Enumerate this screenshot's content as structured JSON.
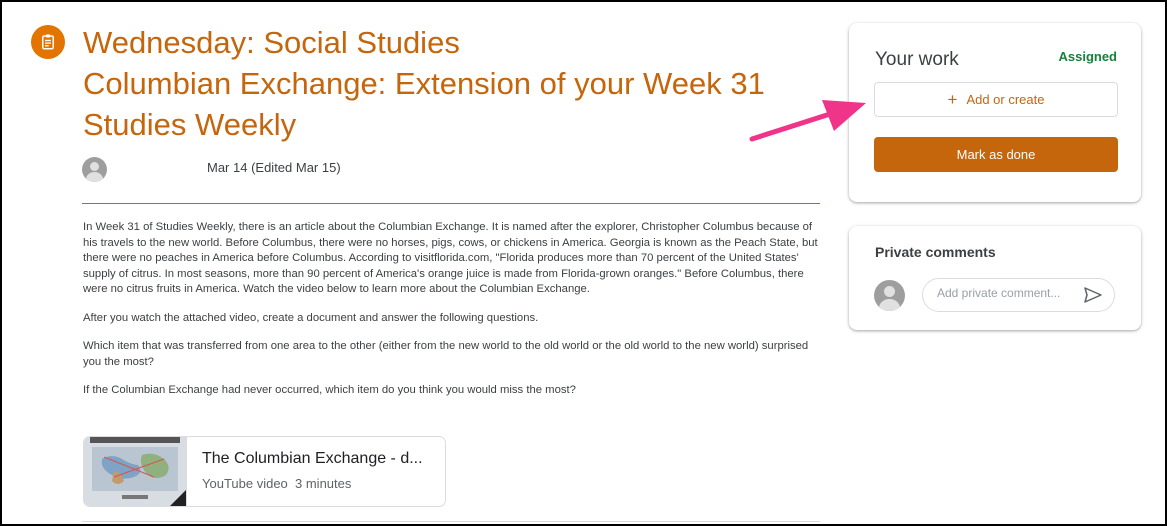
{
  "assignment": {
    "icon": "assignment-icon",
    "title_line1": "Wednesday: Social Studies",
    "title_line2": "Columbian Exchange: Extension of your Week 31 Studies Weekly",
    "date": "Mar 14 (Edited Mar 15)",
    "description": [
      "In Week 31 of Studies Weekly, there is an article about the Columbian Exchange. It is named after the explorer, Christopher Columbus because of his travels to the new world. Before Columbus, there were no horses, pigs, cows, or chickens in America. Georgia is known as the Peach State, but there were no peaches in America before Columbus. According to visitflorida.com, \"Florida produces more than 70 percent of the United States' supply of citrus. In most seasons, more than 90 percent of America's orange juice is made from Florida-grown oranges.\" Before Columbus, there were no citrus fruits in America. Watch the video below to learn more about the Columbian Exchange.",
      "After you watch the attached video, create a document and answer the following questions.",
      "Which item that was transferred from one area to the other (either from the new world to the old world or the old world to the new world) surprised you the most?",
      "If the Columbian Exchange had never occurred, which item do you think you would miss the most?"
    ],
    "attachment": {
      "title": "The Columbian Exchange - d...",
      "type": "YouTube video",
      "duration": "3 minutes"
    }
  },
  "your_work": {
    "title": "Your work",
    "status": "Assigned",
    "add_label": "Add or create",
    "done_label": "Mark as done"
  },
  "private_comments": {
    "title": "Private comments",
    "placeholder": "Add private comment..."
  },
  "colors": {
    "accent": "#c5650c",
    "assigned": "#188038",
    "annotation_arrow": "#f0348a"
  }
}
